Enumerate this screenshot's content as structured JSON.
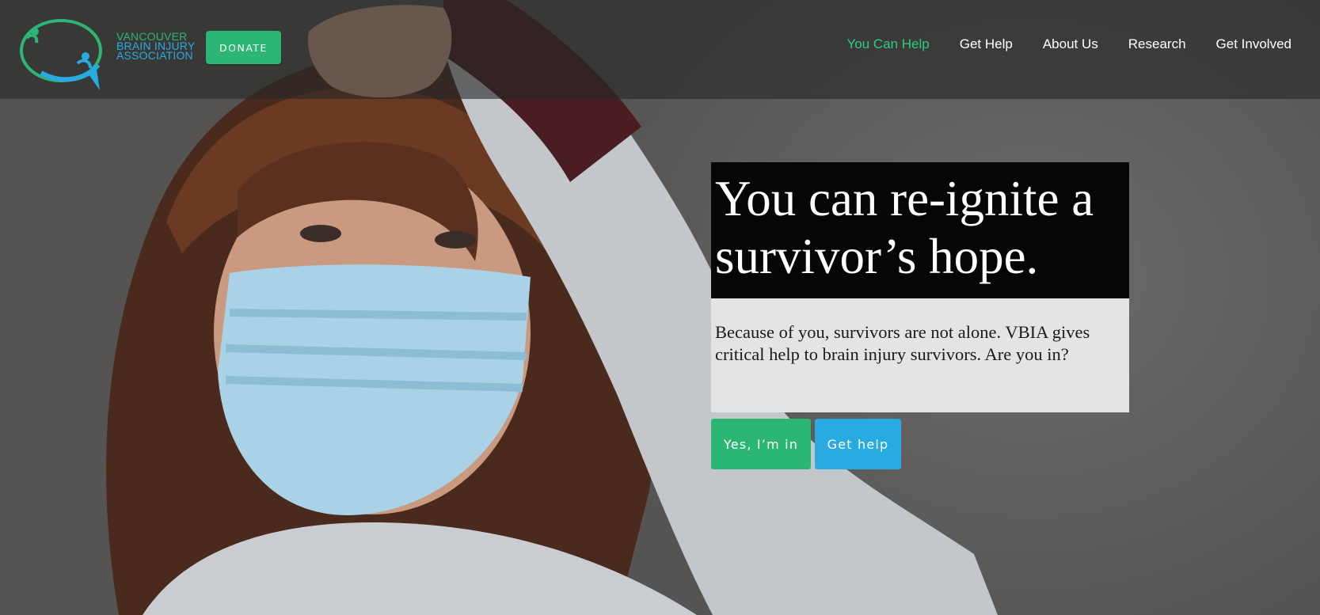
{
  "brand": {
    "line1": "VANCOUVER",
    "line2": "BRAIN INJURY",
    "line3": "ASSOCIATION",
    "green": "#2cb673",
    "blue": "#29abe2"
  },
  "header": {
    "donate_label": "DONATE"
  },
  "nav": {
    "items": [
      {
        "label": "You Can Help",
        "active": true
      },
      {
        "label": "Get Help",
        "active": false
      },
      {
        "label": "About Us",
        "active": false
      },
      {
        "label": "Research",
        "active": false
      },
      {
        "label": "Get Involved",
        "active": false
      }
    ],
    "active_color": "#2ecc7f"
  },
  "hero": {
    "headline": "You can re-ignite a survivor’s hope.",
    "body": "Because of you, survivors are not alone. VBIA gives critical help to brain injury survivors. Are you in?",
    "cta_primary": "Yes, I’m in",
    "cta_secondary": "Get help"
  }
}
